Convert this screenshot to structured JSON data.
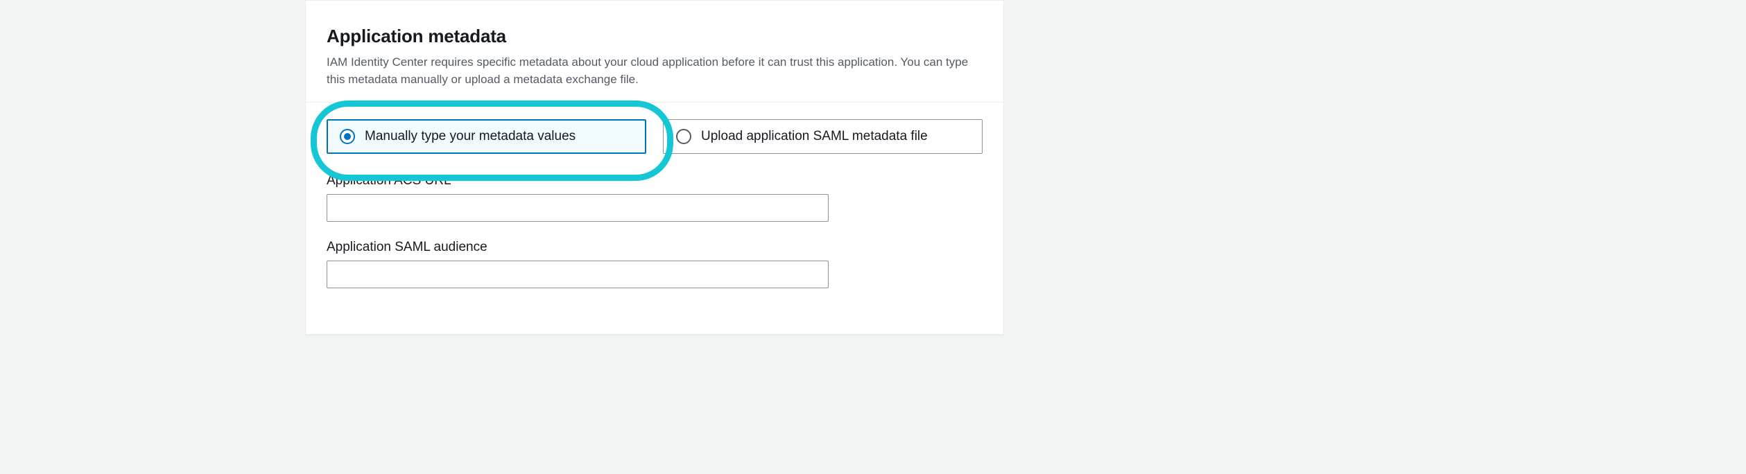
{
  "panel": {
    "title": "Application metadata",
    "description": "IAM Identity Center requires specific metadata about your cloud application before it can trust this application. You can type this metadata manually or upload a metadata exchange file."
  },
  "options": {
    "manual": {
      "label": "Manually type your metadata values",
      "selected": true
    },
    "upload": {
      "label": "Upload application SAML metadata file",
      "selected": false
    }
  },
  "fields": {
    "acs": {
      "label": "Application ACS URL",
      "value": ""
    },
    "audience": {
      "label": "Application SAML audience",
      "value": ""
    }
  },
  "annotation": {
    "highlighted_option": "manual"
  }
}
